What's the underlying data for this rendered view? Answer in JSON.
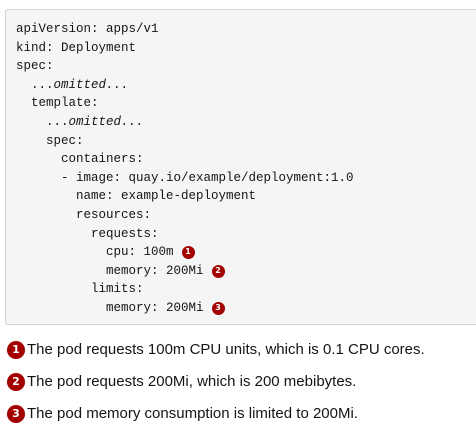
{
  "code": {
    "lines": [
      {
        "text": "apiVersion: apps/v1"
      },
      {
        "text": "kind: Deployment"
      },
      {
        "text": "spec:"
      },
      {
        "prefix": "  ...",
        "italic": "omitted..."
      },
      {
        "text": "  template:"
      },
      {
        "prefix": "    ...",
        "italic": "omitted..."
      },
      {
        "text": "    spec:"
      },
      {
        "text": "      containers:"
      },
      {
        "text": "      - image: quay.io/example/deployment:1.0"
      },
      {
        "text": "        name: example-deployment"
      },
      {
        "text": "        resources:"
      },
      {
        "text": "          requests:"
      },
      {
        "text": "            cpu: 100m",
        "callout": "1"
      },
      {
        "text": "            memory: 200Mi",
        "callout": "2"
      },
      {
        "text": "          limits:"
      },
      {
        "text": "            memory: 200Mi",
        "callout": "3"
      }
    ]
  },
  "callouts": [
    {
      "number": "1",
      "text": "The pod requests 100m CPU units, which is 0.1 CPU cores."
    },
    {
      "number": "2",
      "text": "The pod requests 200Mi, which is 200 mebibytes."
    },
    {
      "number": "3",
      "text": "The pod memory consumption is limited to 200Mi."
    }
  ],
  "colors": {
    "callout_badge": "#a30000",
    "code_background": "#f5f5f5",
    "code_border": "#d2d2d2"
  }
}
